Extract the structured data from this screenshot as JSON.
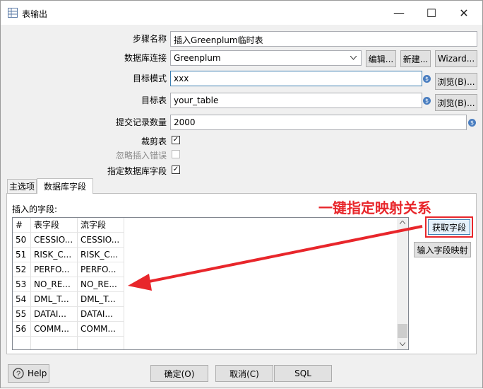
{
  "window": {
    "title": "表输出",
    "app_icon": "table-grid-icon",
    "minimize": "—",
    "maximize": "☐",
    "close": "✕"
  },
  "form": {
    "step_name_label": "步骤名称",
    "step_name_value": "插入Greenplum临时表",
    "db_conn_label": "数据库连接",
    "db_conn_value": "Greenplum",
    "edit_button": "编辑...",
    "new_button": "新建...",
    "wizard_button": "Wizard...",
    "target_schema_label": "目标模式",
    "target_schema_value": "xxx",
    "browse_button_1": "浏览(B)...",
    "target_table_label": "目标表",
    "target_table_value": "your_table",
    "browse_button_2": "浏览(B)...",
    "commit_size_label": "提交记录数量",
    "commit_size_value": "2000",
    "truncate_label": "裁剪表",
    "truncate_checked": true,
    "ignore_errors_label": "忽略插入错误",
    "ignore_errors_checked": false,
    "specify_fields_label": "指定数据库字段",
    "specify_fields_checked": true,
    "var_icon_glyph": "$"
  },
  "tabs": [
    {
      "label": "主选项",
      "active": false
    },
    {
      "label": "数据库字段",
      "active": true
    }
  ],
  "fields_panel": {
    "insert_fields_label": "插入的字段:",
    "columns": [
      "#",
      "表字段",
      "流字段"
    ],
    "rows": [
      [
        "50",
        "CESSIO...",
        "CESSIO..."
      ],
      [
        "51",
        "RISK_C...",
        "RISK_C..."
      ],
      [
        "52",
        "PERFO...",
        "PERFO..."
      ],
      [
        "53",
        "NO_RE...",
        "NO_RE..."
      ],
      [
        "54",
        "DML_T...",
        "DML_T..."
      ],
      [
        "55",
        "DATAI...",
        "DATAI..."
      ],
      [
        "56",
        "COMM...",
        "COMM..."
      ]
    ],
    "get_fields_button": "获取字段",
    "input_mapping_button": "输入字段映射"
  },
  "annotation": {
    "text": "一键指定映射关系",
    "color": "#e8262b"
  },
  "footer": {
    "help": "Help",
    "ok": "确定(O)",
    "cancel": "取消(C)",
    "sql": "SQL"
  }
}
